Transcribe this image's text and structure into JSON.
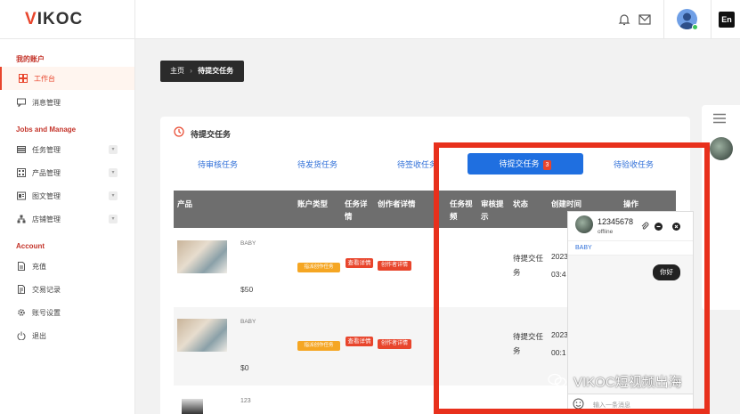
{
  "brand": {
    "logo_v": "V",
    "logo_rest": "IKOC"
  },
  "header": {
    "lang": "En"
  },
  "sidebar": {
    "section_my": "我的账户",
    "items_top": [
      {
        "label": "工作台",
        "icon": "dashboard-icon",
        "active": true
      },
      {
        "label": "消息管理",
        "icon": "message-icon"
      }
    ],
    "section_jobs": "Jobs and Manage",
    "items_jobs": [
      {
        "label": "任务管理",
        "icon": "task-icon"
      },
      {
        "label": "产品管理",
        "icon": "product-icon"
      },
      {
        "label": "图文管理",
        "icon": "image-text-icon"
      },
      {
        "label": "店铺管理",
        "icon": "store-icon"
      }
    ],
    "section_account": "Account",
    "items_account": [
      {
        "label": "充值",
        "icon": "recharge-icon"
      },
      {
        "label": "交易记录",
        "icon": "transactions-icon"
      },
      {
        "label": "账号设置",
        "icon": "settings-icon"
      },
      {
        "label": "退出",
        "icon": "logout-icon"
      }
    ]
  },
  "breadcrumb": {
    "home": "主页",
    "sep": "›",
    "current": "待提交任务"
  },
  "card": {
    "title": "待提交任务",
    "tabs": [
      "待审核任务",
      "待发货任务",
      "待签收任务",
      "待提交任务",
      "待验收任务"
    ],
    "active_badge": "3",
    "columns": [
      "产品",
      "账户类型",
      "任务详情",
      "创作者详情",
      "任务视频",
      "审核提示",
      "状态",
      "创建时间",
      "操作"
    ],
    "rows": [
      {
        "name": "BABY",
        "price": "$50",
        "tag": "指派创作任务",
        "detail": "查看详情",
        "creator": "创作者详情",
        "status": "待提交任务",
        "date_a": "2023",
        "date_b": "03:4"
      },
      {
        "name": "BABY",
        "price": "$0",
        "tag": "指派创作任务",
        "detail": "查看详情",
        "creator": "创作者详情",
        "status": "待提交任务",
        "date_a": "2023",
        "date_b": "00:1"
      },
      {
        "name": "123"
      }
    ]
  },
  "chat": {
    "user": "12345678",
    "status": "offline",
    "product": "BABY",
    "message": "你好",
    "placeholder": "输入一条消息"
  },
  "watermark": "VIKOC短视频出海",
  "colors": {
    "accent": "#e8452c",
    "blue": "#1f6fe0",
    "highlight": "#e8301c"
  }
}
